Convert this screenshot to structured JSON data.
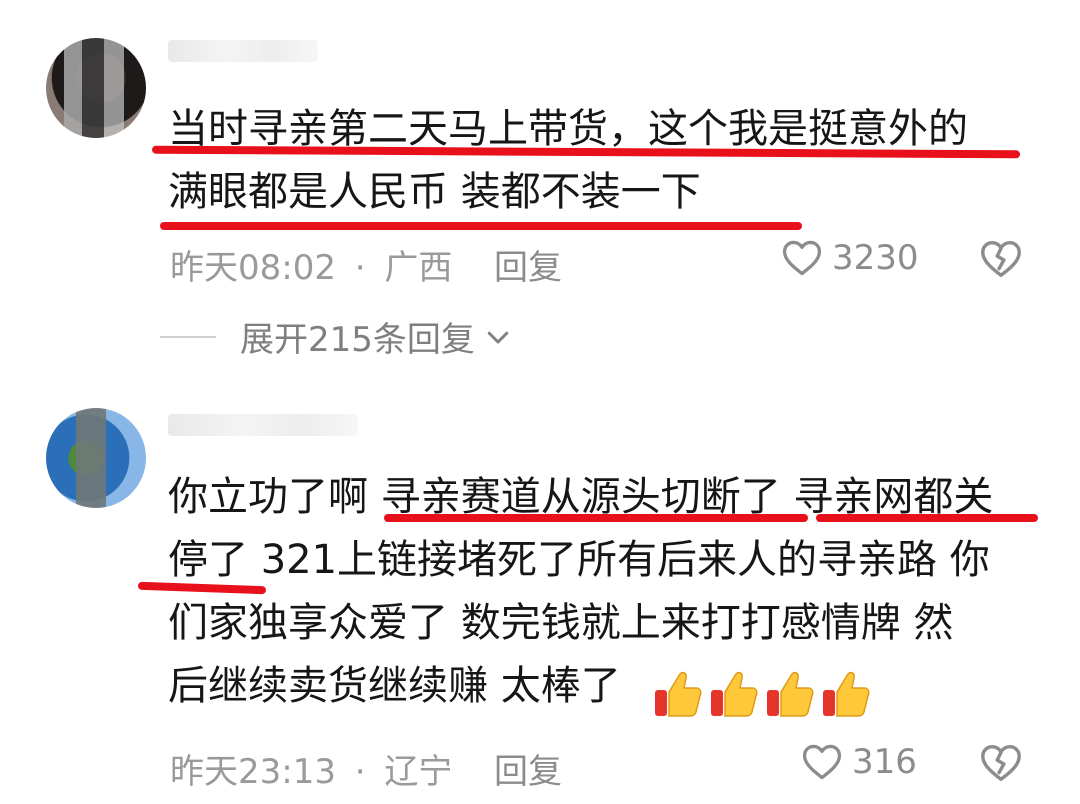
{
  "comments": [
    {
      "lines": [
        "当时寻亲第二天马上带货，这个我是挺意外的",
        "满眼都是人民币  装都不装一下"
      ],
      "time": "昨天08:02",
      "separator": "·",
      "location": "广西",
      "reply_label": "回复",
      "likes": "3230"
    },
    {
      "lines": [
        "你立功了啊 寻亲赛道从源头切断了 寻亲网都关",
        "停了 321上链接堵死了所有后来人的寻亲路 你",
        "们家独享众爱了  数完钱就上来打打感情牌 然",
        "后继续卖货继续赚 太棒了"
      ],
      "time": "昨天23:13",
      "separator": "·",
      "location": "辽宁",
      "reply_label": "回复",
      "likes": "316",
      "emoji": [
        "thumbs-up",
        "thumbs-up",
        "thumbs-up",
        "thumbs-up"
      ]
    }
  ],
  "expand_replies": {
    "label": "展开215条回复"
  },
  "colors": {
    "underline": "#e8101a",
    "text": "#161616",
    "meta": "#9a9a9a"
  }
}
